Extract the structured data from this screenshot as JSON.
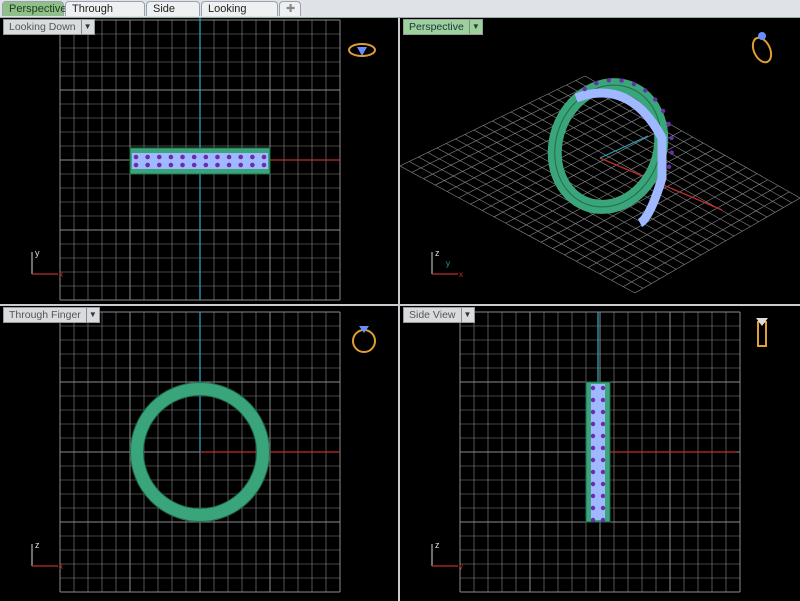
{
  "tabs": [
    {
      "label": "Perspective",
      "active": true
    },
    {
      "label": "Through Finger",
      "active": false
    },
    {
      "label": "Side View",
      "active": false
    },
    {
      "label": "Looking Down",
      "active": false
    }
  ],
  "add_tab_icon": "plus-icon",
  "viewports": {
    "top_left": {
      "label": "Looking Down",
      "axes": [
        "y",
        "x"
      ]
    },
    "top_right": {
      "label": "Perspective",
      "axes": [
        "z",
        "y",
        "x"
      ]
    },
    "bottom_left": {
      "label": "Through Finger",
      "axes": [
        "z",
        "x"
      ]
    },
    "bottom_right": {
      "label": "Side View",
      "axes": [
        "z",
        "y"
      ]
    }
  },
  "colors": {
    "grid": "#8a8a8a",
    "x_axis": "#c0302a",
    "y_axis": "#2aa0b8",
    "ring": "#3aa57a",
    "gem": "#9fb8ff",
    "prong": "#6a2ca8",
    "active_tab": "#8fc08a"
  }
}
